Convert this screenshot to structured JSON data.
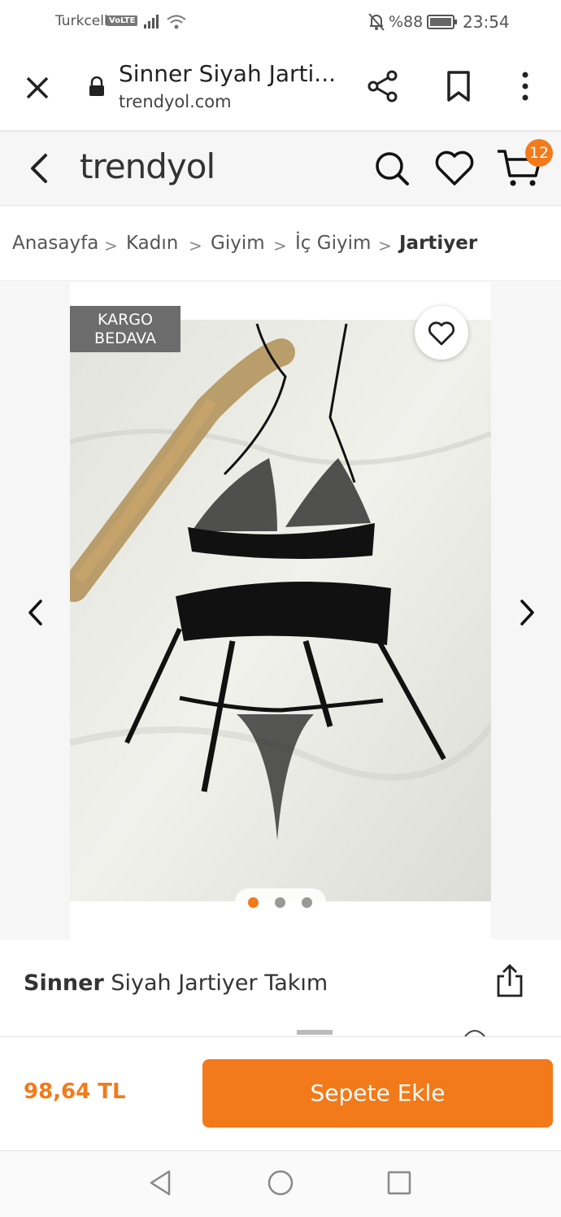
{
  "status_bar": {
    "carrier": "Turkcell",
    "volte": "VoLTE",
    "battery": "%88",
    "time": "23:54"
  },
  "browser": {
    "title": "Sinner Siyah Jarti...",
    "url": "trendyol.com",
    "icons": [
      "close-icon",
      "lock-icon",
      "share-icon",
      "bookmark-icon",
      "more-vertical-icon"
    ]
  },
  "header": {
    "logo": "trendyol",
    "cart_count": "12",
    "icons": [
      "back-arrow-icon",
      "search-icon",
      "heart-icon",
      "cart-icon"
    ]
  },
  "breadcrumb": {
    "items": [
      "Anasayfa",
      "Kadın",
      "Giyim",
      "İç Giyim",
      "Jartiyer"
    ],
    "separator": ">"
  },
  "gallery": {
    "badge_line1": "KARGO",
    "badge_line2": "BEDAVA",
    "image_count": 3,
    "active_index": 0
  },
  "product": {
    "brand": "Sinner",
    "name": " Siyah Jartiyer Takım"
  },
  "action_bar": {
    "price": "98,64 TL",
    "add_to_cart": "Sepete Ekle"
  },
  "colors": {
    "accent": "#f27a1a",
    "badge_bg": "#6c6c6c"
  }
}
